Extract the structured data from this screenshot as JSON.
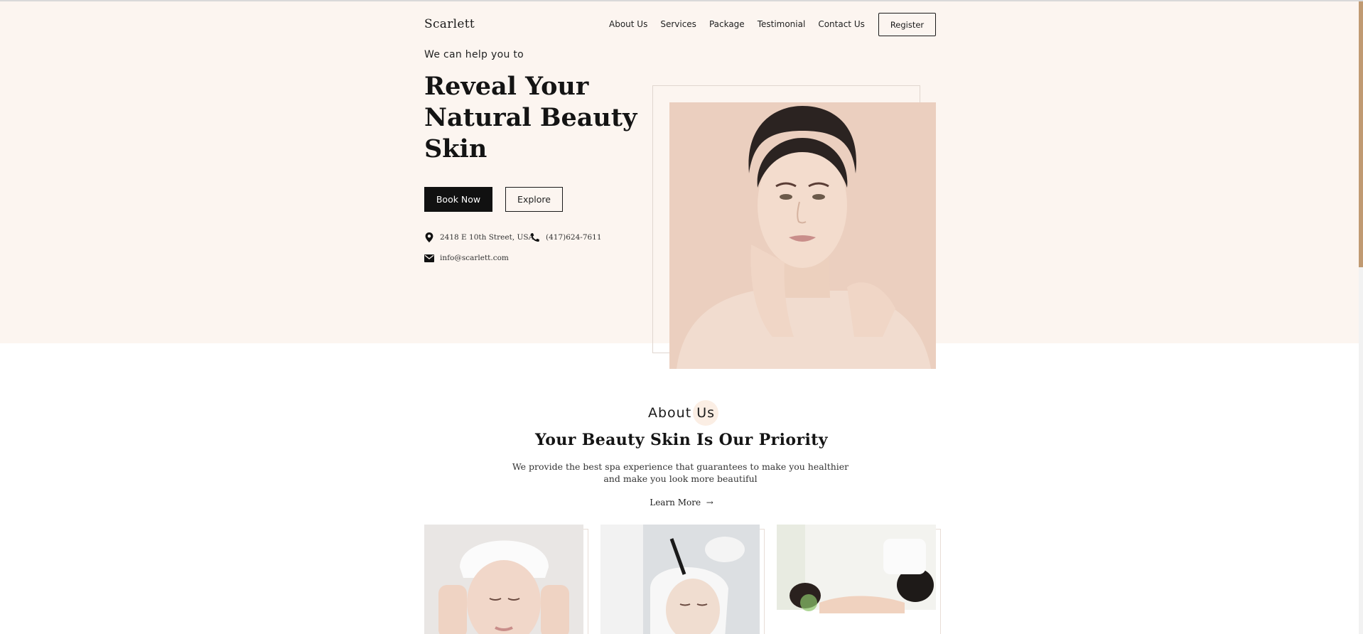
{
  "brand": {
    "name": "Scarlett"
  },
  "nav": {
    "items": [
      {
        "label": "About Us"
      },
      {
        "label": "Services"
      },
      {
        "label": "Package"
      },
      {
        "label": "Testimonial"
      },
      {
        "label": "Contact Us"
      }
    ],
    "register_label": "Register"
  },
  "hero": {
    "eyebrow": "We can help you to",
    "headline": "Reveal Your Natural Beauty Skin",
    "book_label": "Book Now",
    "explore_label": "Explore",
    "address": "2418 E 10th Street, USA",
    "phone": "(417)624-7611",
    "email": "info@scarlett.com",
    "address_icon": "location-pin-icon",
    "phone_icon": "phone-icon",
    "email_icon": "envelope-icon"
  },
  "about": {
    "tag": "About Us",
    "title": "Your Beauty Skin Is Our Priority",
    "description": "We provide the best spa experience that guarantees to make you healthier and make you look more beautiful",
    "learn_more_label": "Learn More",
    "learn_more_icon": "arrow-right-icon"
  },
  "colors": {
    "hero_background": "#fcf5f0",
    "accent": "#c09a72",
    "dark": "#111111",
    "photo_background": "#ebcfbf"
  }
}
